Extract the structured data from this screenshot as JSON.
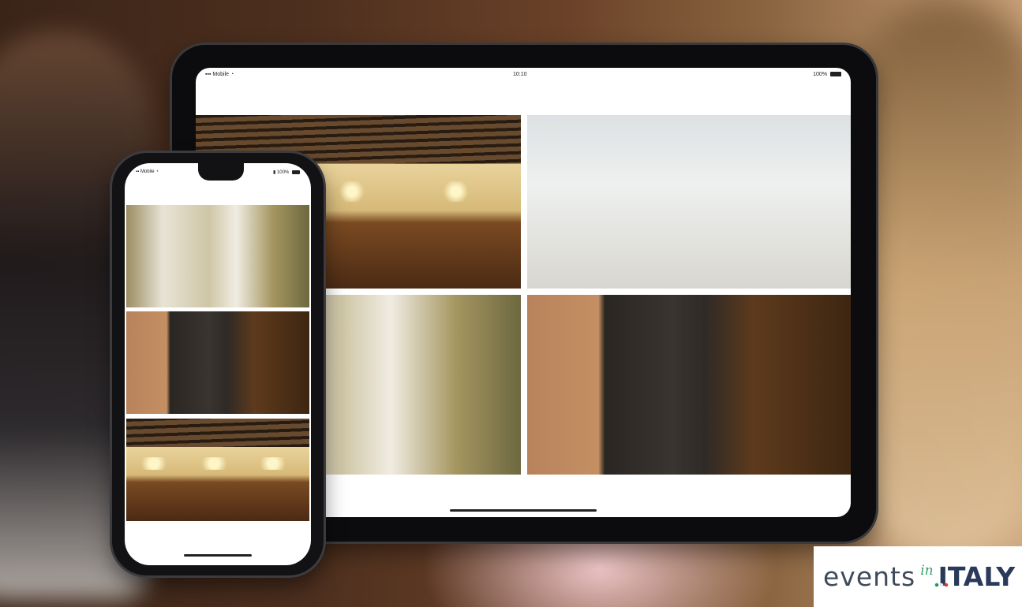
{
  "tablet": {
    "status": {
      "carrier": "Mobile",
      "time": "10:10",
      "battery": "100%"
    },
    "photos": [
      "hall",
      "couple",
      "corridor",
      "door"
    ]
  },
  "phone": {
    "status": {
      "carrier": "Mobile",
      "battery": "100%"
    },
    "photos": [
      "corridor",
      "door",
      "hall"
    ]
  },
  "logo": {
    "word1": "events",
    "word2": "in",
    "word3": "ITALY"
  },
  "icons": [
    "signal-icon",
    "wifi-icon",
    "battery-icon",
    "lock-icon"
  ]
}
